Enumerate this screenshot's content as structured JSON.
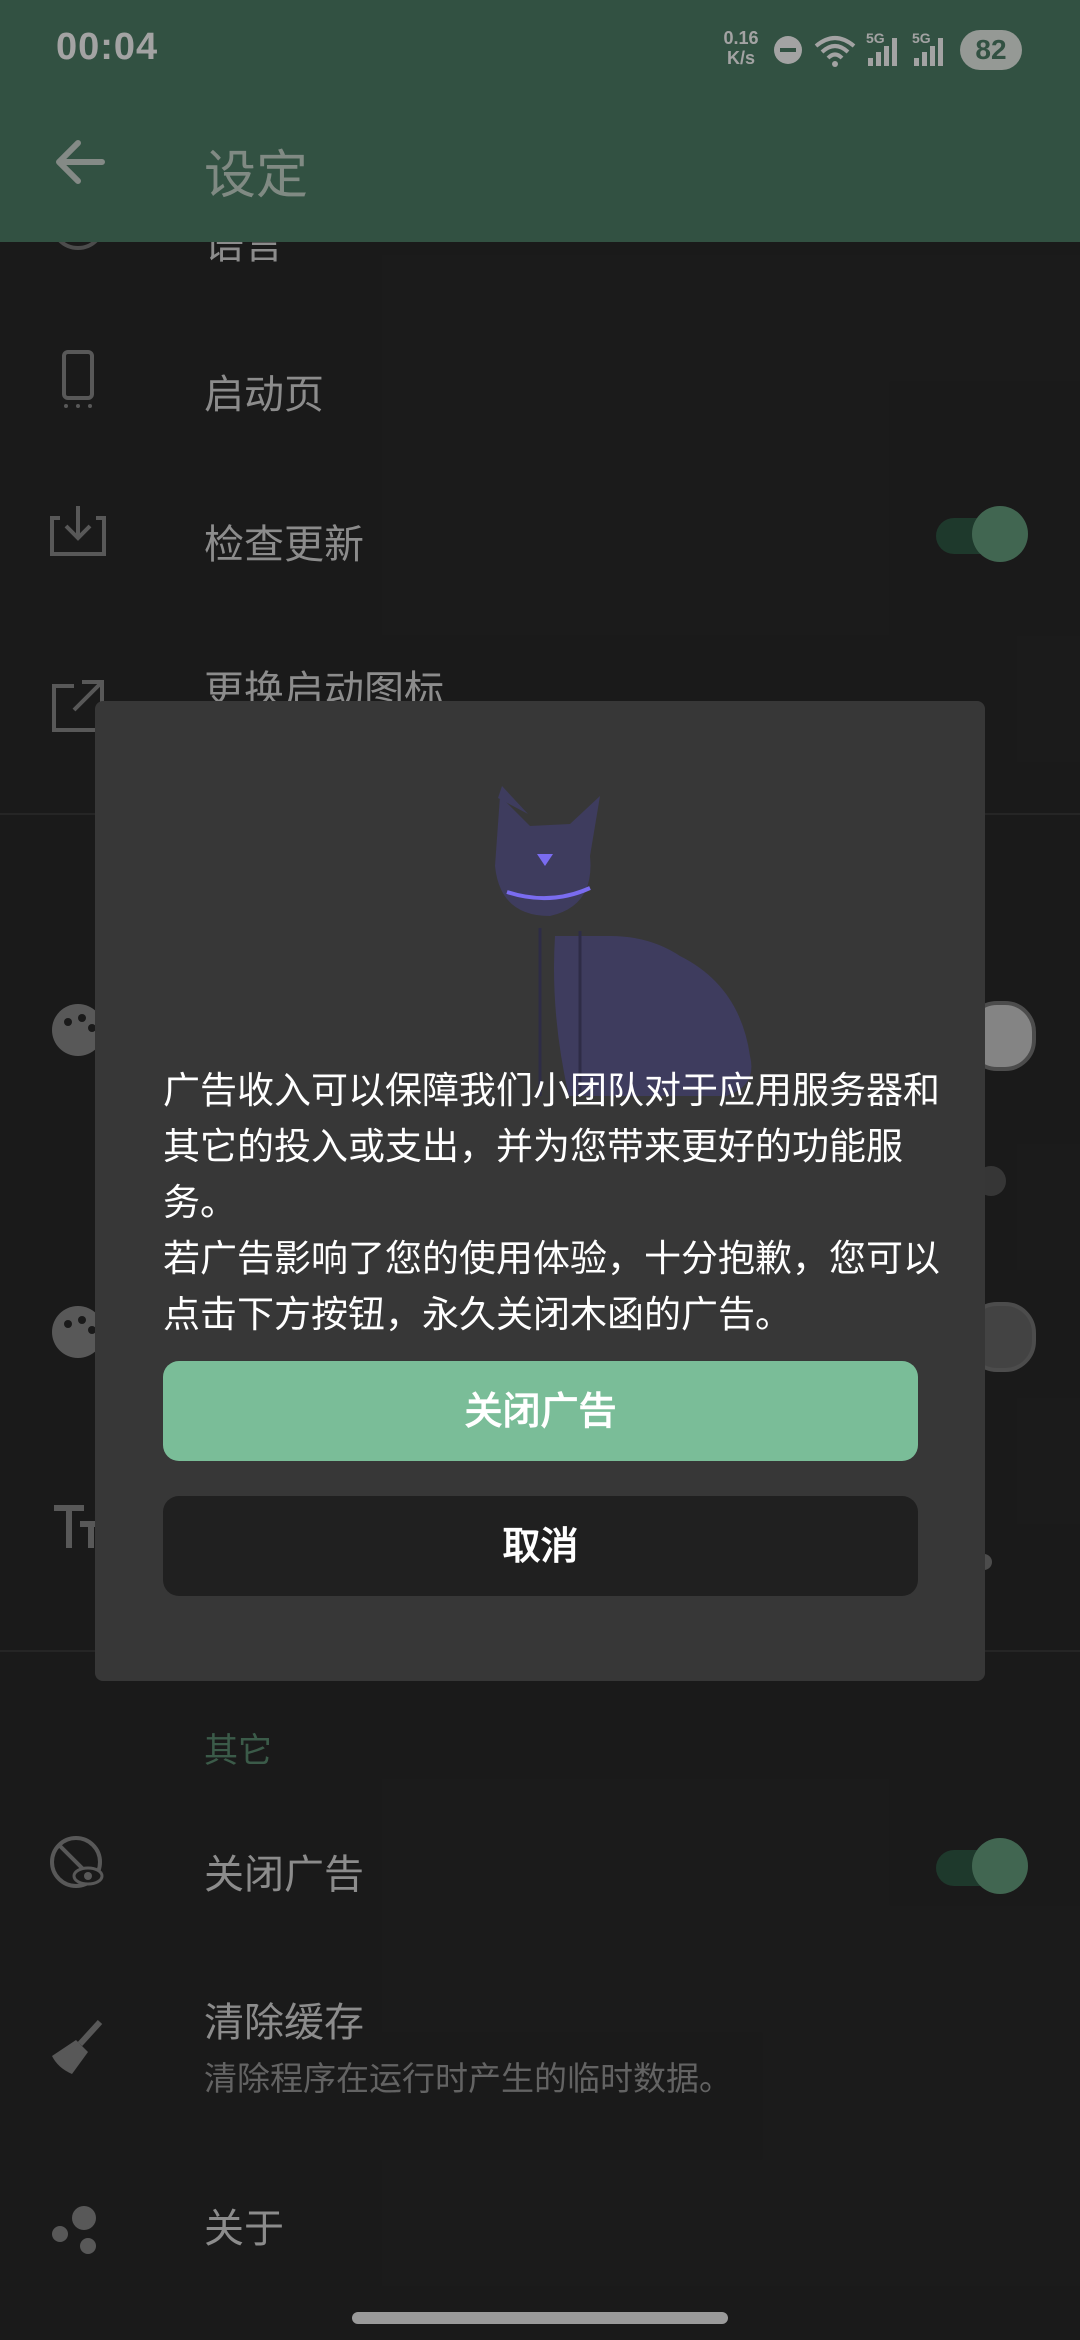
{
  "status_bar": {
    "time": "00:04",
    "net_speed_value": "0.16",
    "net_speed_unit": "K/s",
    "signal1_label": "5G",
    "signal2_label": "5G",
    "battery": "82",
    "icons": [
      "do-not-disturb-icon",
      "wifi-icon",
      "signal-icon",
      "signal-icon"
    ]
  },
  "appbar": {
    "title": "设定"
  },
  "settings": {
    "partial_top_label": "语言",
    "items": [
      {
        "label": "启动页",
        "icon": "phone-icon"
      },
      {
        "label": "检查更新",
        "icon": "download-icon",
        "toggle": true
      },
      {
        "label": "更换启动图标",
        "icon": "open-external-icon"
      }
    ],
    "section_other": "其它",
    "other_items": [
      {
        "label": "关闭广告",
        "icon": "eye-off-icon",
        "toggle": true
      },
      {
        "label": "清除缓存",
        "sub": "清除程序在运行时产生的临时数据。",
        "icon": "broom-icon"
      },
      {
        "label": "关于",
        "icon": "dots-icon"
      }
    ]
  },
  "dialog": {
    "message": "广告收入可以保障我们小团队对于应用服务器和其它的投入或支出，并为您带来更好的功能服务。\n若广告影响了您的使用体验，十分抱歉，您可以点击下方按钮，永久关闭木函的广告。",
    "primary_button": "关闭广告",
    "secondary_button": "取消"
  },
  "colors": {
    "accent": "#4f7f68",
    "button_primary": "#7abd98",
    "section": "#5d8f73"
  }
}
